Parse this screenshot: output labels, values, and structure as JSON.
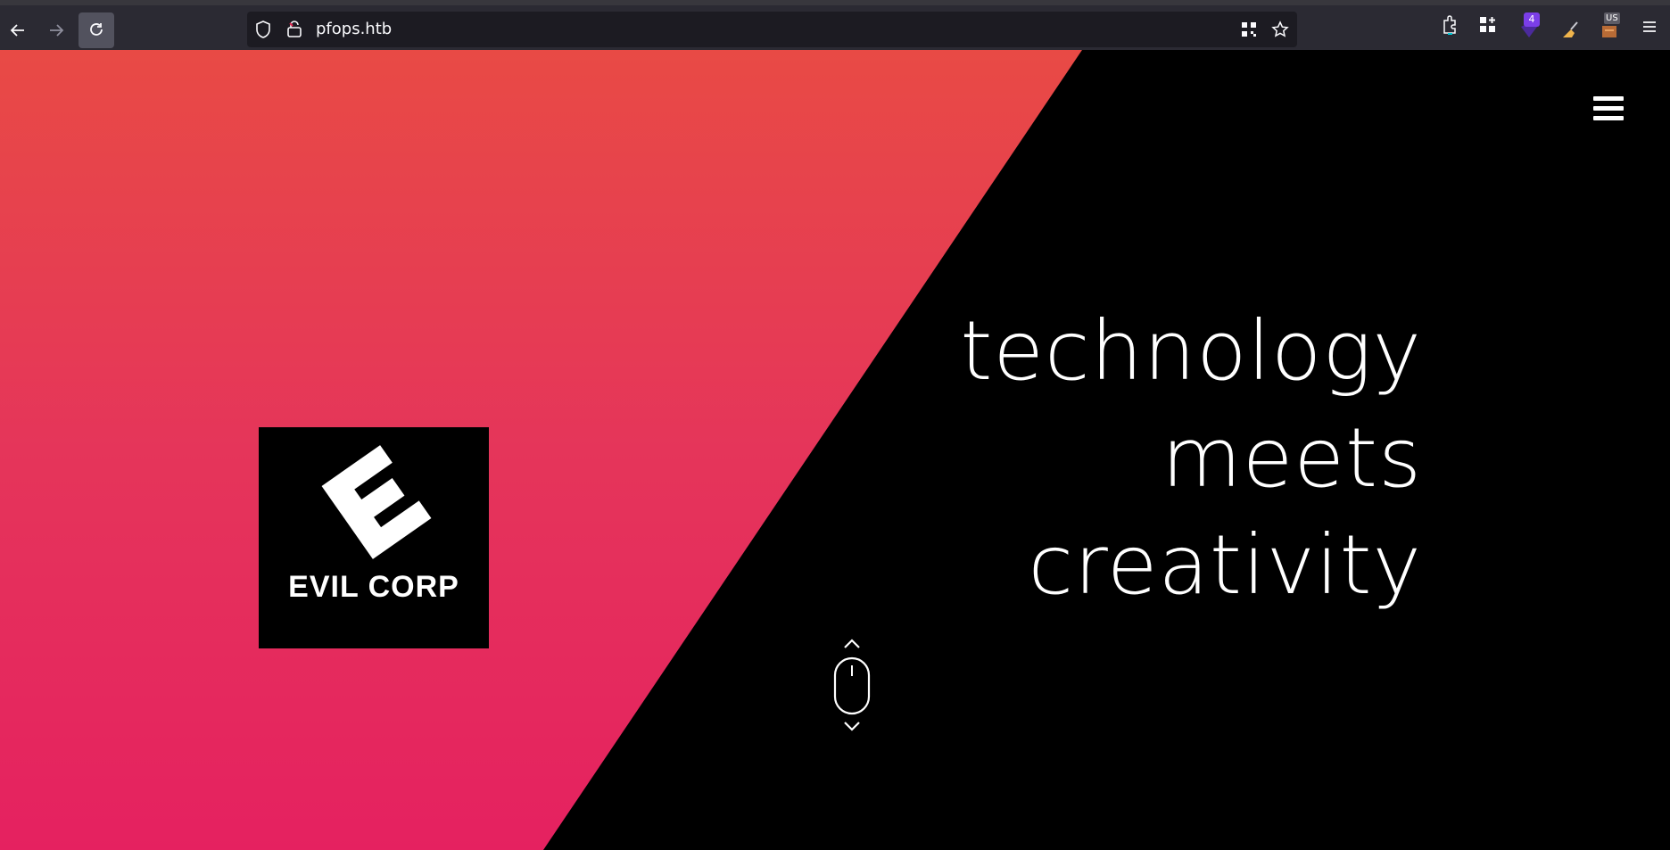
{
  "browser": {
    "url": "pfops.htb",
    "extension_badge_count": "4",
    "extension_label": "US",
    "icons": [
      "back-arrow-icon",
      "forward-arrow-icon",
      "reload-icon",
      "shield-icon",
      "lock-warning-icon",
      "qr-code-icon",
      "star-icon",
      "extensions-icon",
      "container-icon",
      "ublock-icon",
      "broom-icon",
      "us-extension-icon",
      "hamburger-menu-icon"
    ]
  },
  "page": {
    "logo": {
      "text": "EVIL CORP"
    },
    "hero_lines": [
      "technology",
      "meets",
      "creativity"
    ],
    "colors": {
      "gradient_top": "#e84a45",
      "gradient_bottom": "#e52160",
      "background": "#000000",
      "text": "#ffffff"
    }
  }
}
